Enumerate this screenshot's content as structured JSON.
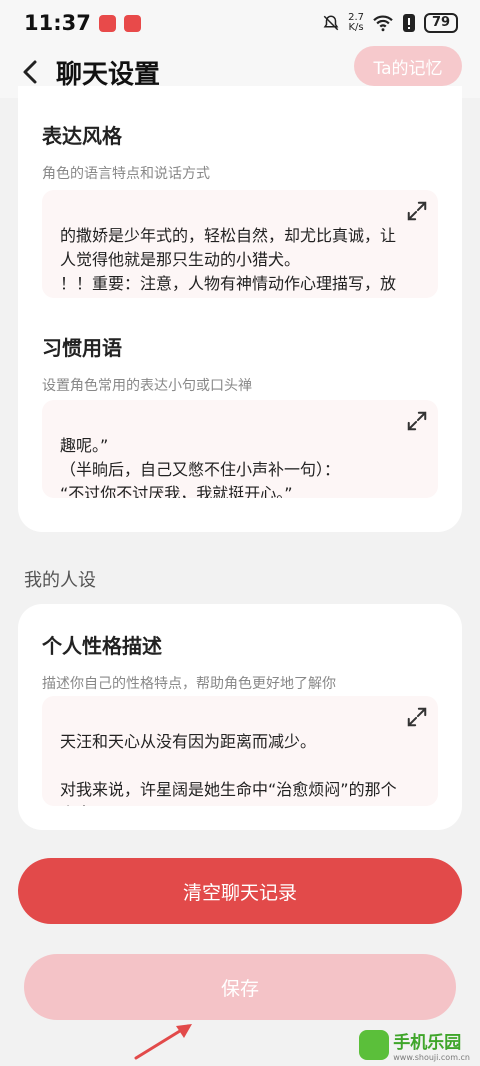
{
  "status": {
    "time": "11:37",
    "netspeed_value": "2.7",
    "netspeed_unit": "K/s",
    "battery": "79"
  },
  "header": {
    "title": "聊天设置",
    "memory_button": "Ta的记忆"
  },
  "role": {
    "style": {
      "title": "表达风格",
      "desc": "角色的语言特点和说话方式",
      "text": "的撒娇是少年式的，轻松自然，却尤比真诚，让人觉得他就是那只生动的小猎犬。\n！！重要：注意，人物有神情动作心理描写，放在（）里表示"
    },
    "phrases": {
      "title": "习惯用语",
      "desc": "设置角色常用的表达小句或口头禅",
      "text": "趣呢。”\n（半晌后，自己又憋不住小声补一句）：\n“不过你不讨厌我，我就挺开心。”"
    }
  },
  "persona": {
    "group_label": "我的人设",
    "title": "个人性格描述",
    "desc": "描述你自己的性格特点，帮助角色更好地了解你",
    "text": "天汪和天心从没有因为距离而减少。\n\n对我来说，许星阔是她生命中“治愈烦闷”的那个小太阳。"
  },
  "actions": {
    "clear": "清空聊天记录",
    "save": "保存"
  },
  "watermark": {
    "name": "手机乐园",
    "url": "www.shouji.com.cn"
  },
  "colors": {
    "accent": "#e24a4a",
    "accent_light": "#f4c3c7"
  }
}
